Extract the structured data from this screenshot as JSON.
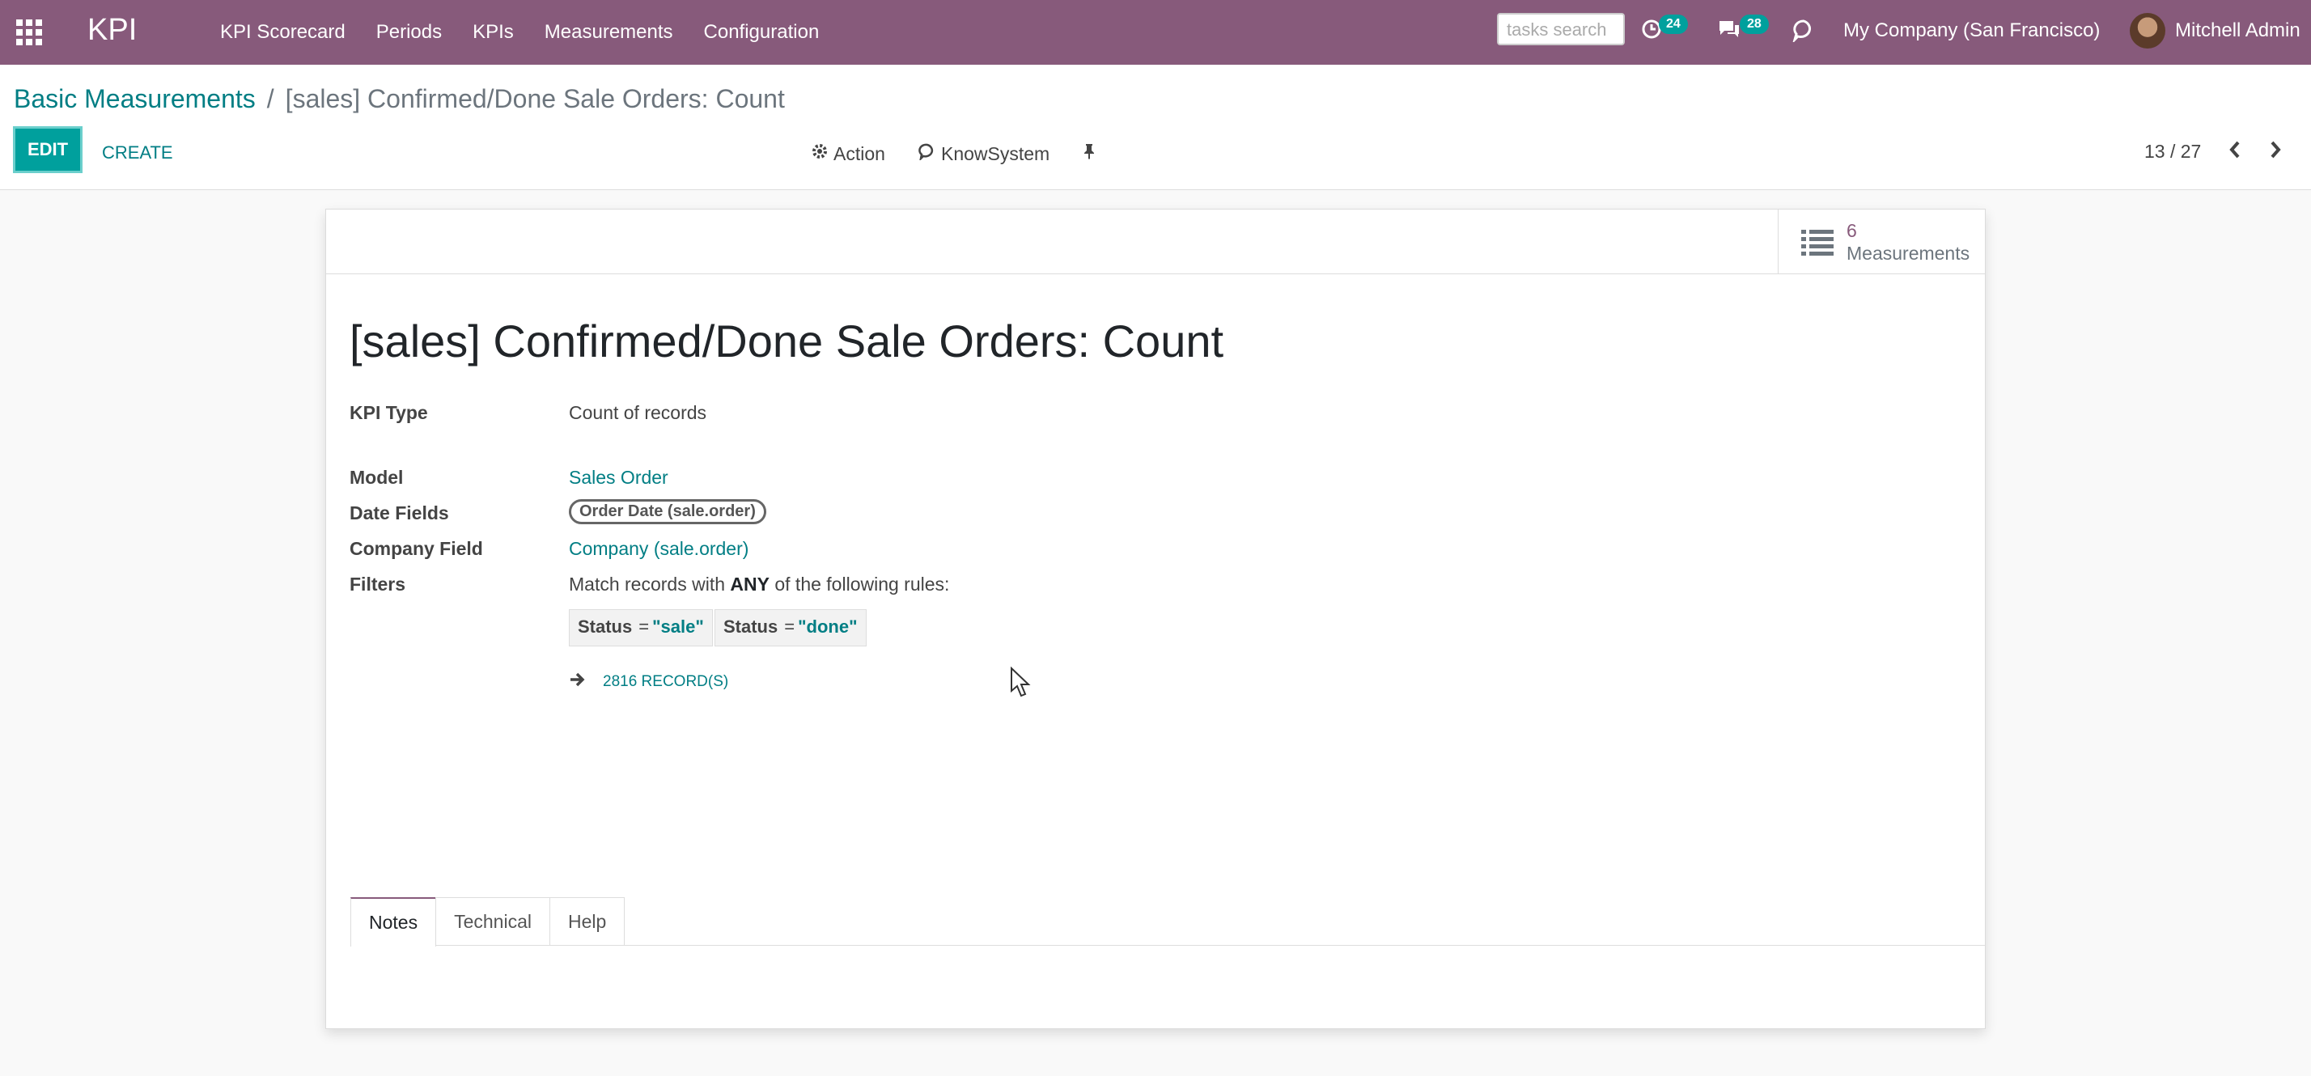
{
  "navbar": {
    "brand": "KPI",
    "menu": [
      "KPI Scorecard",
      "Periods",
      "KPIs",
      "Measurements",
      "Configuration"
    ],
    "search_placeholder": "tasks search",
    "activity_count": "24",
    "message_count": "28",
    "company": "My Company (San Francisco)",
    "user": "Mitchell Admin"
  },
  "breadcrumb": {
    "parent": "Basic Measurements",
    "separator": "/",
    "current": "[sales] Confirmed/Done Sale Orders: Count"
  },
  "toolbar": {
    "edit_label": "EDIT",
    "create_label": "CREATE",
    "action_label": "Action",
    "knowsystem_label": "KnowSystem",
    "pager_value": "13 / 27"
  },
  "stat_button": {
    "value": "6",
    "label": "Measurements"
  },
  "record": {
    "title": "[sales] Confirmed/Done Sale Orders: Count",
    "fields": {
      "kpi_type": {
        "label": "KPI Type",
        "value": "Count of records"
      },
      "model": {
        "label": "Model",
        "value": "Sales Order"
      },
      "date_fields": {
        "label": "Date Fields",
        "value": "Order Date (sale.order)"
      },
      "company_field": {
        "label": "Company Field",
        "value": "Company (sale.order)"
      },
      "filters": {
        "label": "Filters",
        "intro_prefix": "Match records with",
        "intro_bold": "ANY",
        "intro_suffix": "of the following rules:",
        "rules": [
          {
            "field": "Status",
            "operator": "=",
            "value": "\"sale\""
          },
          {
            "field": "Status",
            "operator": "=",
            "value": "\"done\""
          }
        ],
        "records_label": "2816 RECORD(S)"
      }
    }
  },
  "tabs": [
    "Notes",
    "Technical",
    "Help"
  ],
  "colors": {
    "navbar": "#875a7b",
    "accent": "#00a09d",
    "link": "#017e84"
  }
}
